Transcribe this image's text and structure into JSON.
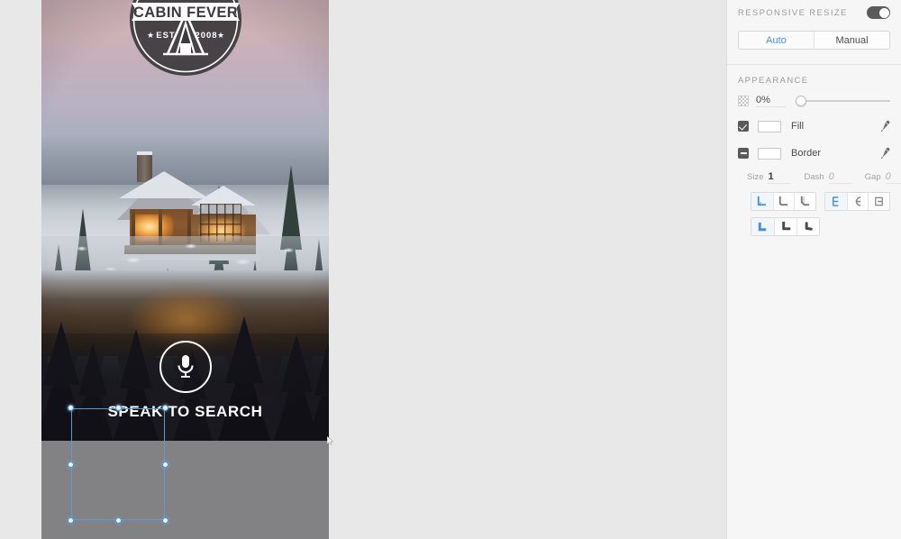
{
  "app": {
    "canvas_background": "#e8e8e8",
    "accent_color": "#4a90d9",
    "selection_color": "#5b9bd5"
  },
  "artboard": {
    "name": "mobile-artboard",
    "logo": {
      "brand_line": "CABIN FEVER",
      "est_label": "EST",
      "est_year": "2008",
      "star_glyph": "★",
      "icon": "tent-icon"
    },
    "hero": {
      "image_description": "snowy-cabin-at-dusk-photo",
      "mic_icon": "microphone-icon",
      "caption": "SPEAK TO SEARCH"
    },
    "selection": {
      "handle_count": 8,
      "handles": [
        "nw",
        "n",
        "ne",
        "w",
        "e",
        "sw",
        "s",
        "se"
      ]
    }
  },
  "panel": {
    "responsive_resize": {
      "title": "RESPONSIVE RESIZE",
      "toggle_state": "on",
      "modes": [
        {
          "label": "Auto",
          "selected": true
        },
        {
          "label": "Manual",
          "selected": false
        }
      ]
    },
    "appearance": {
      "title": "APPEARANCE",
      "opacity": {
        "icon": "checkerboard-icon",
        "value": "0%",
        "slider_position_percent": 0
      },
      "fill": {
        "label": "Fill",
        "enabled": true,
        "checkbox_state": "checked",
        "swatch_color": "#ffffff",
        "eyedropper_icon": "eyedropper-icon"
      },
      "border": {
        "label": "Border",
        "enabled": true,
        "checkbox_state": "indeterminate",
        "swatch_color": "#ffffff",
        "eyedropper_icon": "eyedropper-icon"
      },
      "stroke_fields": [
        {
          "key": "Size",
          "value": "1",
          "is_zero": false
        },
        {
          "key": "Dash",
          "value": "0",
          "is_zero": true
        },
        {
          "key": "Gap",
          "value": "0",
          "is_zero": true
        }
      ],
      "join_buttons": [
        {
          "name": "miter-join-button",
          "selected": true
        },
        {
          "name": "round-join-button",
          "selected": false
        },
        {
          "name": "bevel-join-button",
          "selected": false
        }
      ],
      "align_buttons": [
        {
          "name": "stroke-align-center-button",
          "selected": true
        },
        {
          "name": "stroke-align-inside-button",
          "selected": false
        },
        {
          "name": "stroke-align-outside-button",
          "selected": false
        }
      ],
      "cap_buttons": [
        {
          "name": "butt-cap-button",
          "selected": true
        },
        {
          "name": "square-cap-button",
          "selected": false
        },
        {
          "name": "round-cap-button",
          "selected": false
        }
      ]
    }
  }
}
